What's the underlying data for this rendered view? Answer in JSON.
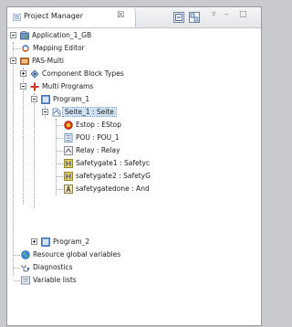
{
  "panel": {
    "title": "Project Manager",
    "close_glyph": "☒",
    "tools": [
      "collapse-all-icon",
      "link-editor-icon"
    ],
    "minimize_glyph": "–",
    "maximize_glyph": "□"
  },
  "tree": [
    {
      "label": "Application_1_GB",
      "icon": "application-icon"
    },
    {
      "label": "Mapping Editor",
      "icon": "mapping-editor-icon"
    },
    {
      "label": "PAS-Multi",
      "icon": "pas-multi-icon"
    },
    {
      "label": "Component Block Types",
      "icon": "component-block-types-icon"
    },
    {
      "label": "Multi Programs",
      "icon": "multi-programs-icon"
    },
    {
      "label": "Program_1",
      "icon": "program-icon"
    },
    {
      "label": "Seite_1 : Seite",
      "icon": "page-icon"
    },
    {
      "label": "Estop : EStop",
      "icon": "estop-icon"
    },
    {
      "label": "POU : POU_1",
      "icon": "pou-icon"
    },
    {
      "label": "Relay : Relay",
      "icon": "relay-icon"
    },
    {
      "label": "Safetygate1 : Safetyc",
      "icon": "safetygate-icon"
    },
    {
      "label": "safetygate2 : SafetyG",
      "icon": "safetygate-icon"
    },
    {
      "label": "safetygatedone : And",
      "icon": "and-block-icon"
    },
    {
      "label": "Program_2",
      "icon": "program-icon"
    },
    {
      "label": "Resource global variables",
      "icon": "globe-icon"
    },
    {
      "label": "Diagnostics",
      "icon": "diagnostics-icon"
    },
    {
      "label": "Variable lists",
      "icon": "variable-lists-icon"
    }
  ]
}
